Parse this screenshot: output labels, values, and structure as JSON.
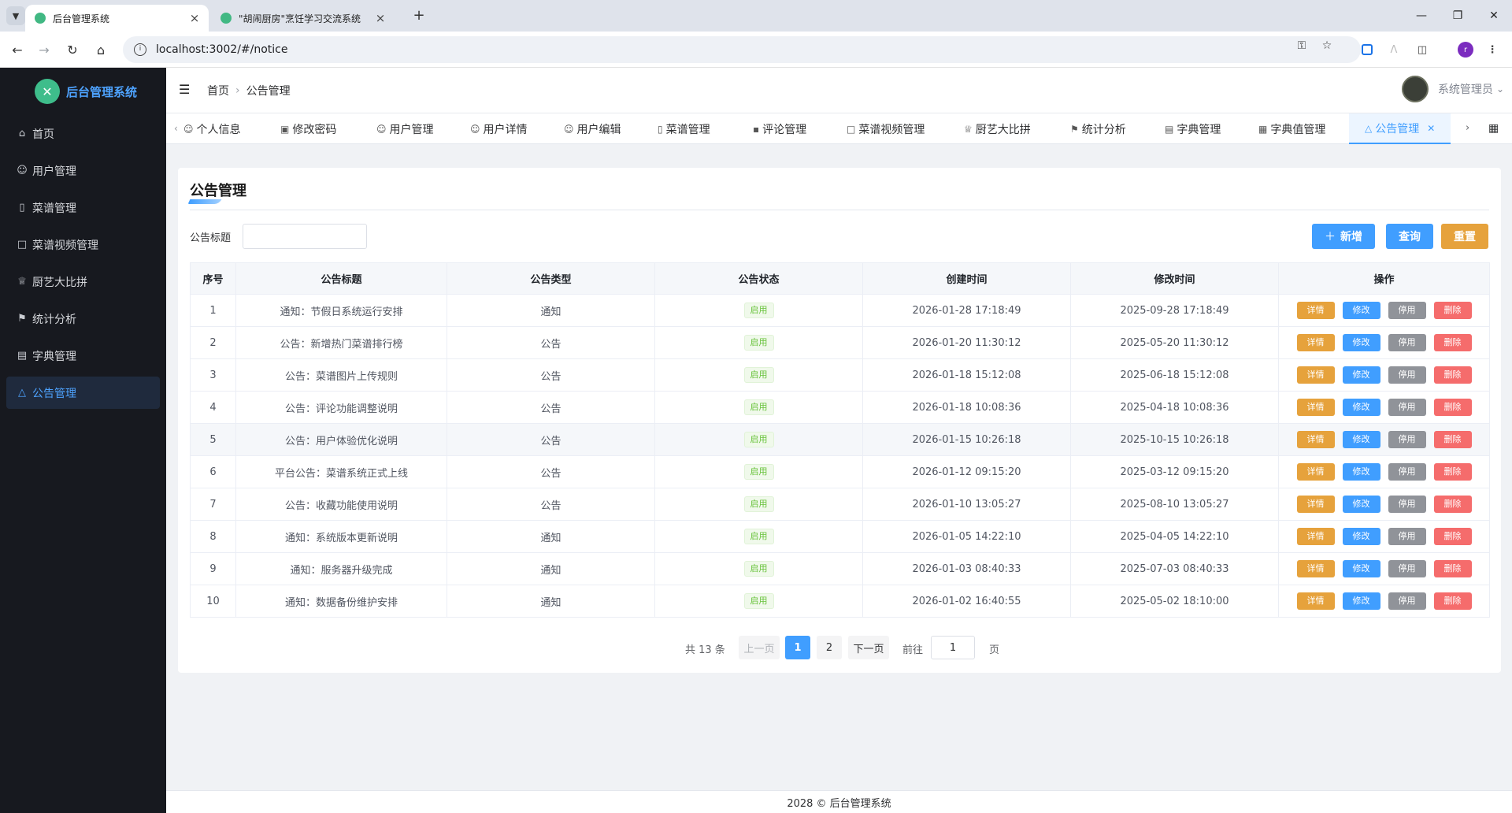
{
  "browser": {
    "tabs": [
      {
        "title": "后台管理系统",
        "active": true
      },
      {
        "title": "\"胡闹厨房\"烹饪学习交流系统",
        "active": false
      }
    ],
    "url": "localhost:3002/#/notice",
    "profile_initial": "r"
  },
  "sidebar": {
    "app_name": "后台管理系统",
    "items": [
      {
        "label": "首页",
        "icon": "home-icon"
      },
      {
        "label": "用户管理",
        "icon": "user-icon"
      },
      {
        "label": "菜谱管理",
        "icon": "book-icon"
      },
      {
        "label": "菜谱视频管理",
        "icon": "video-icon"
      },
      {
        "label": "厨艺大比拼",
        "icon": "trophy-icon"
      },
      {
        "label": "统计分析",
        "icon": "flag-icon"
      },
      {
        "label": "字典管理",
        "icon": "document-icon"
      },
      {
        "label": "公告管理",
        "icon": "bell-icon",
        "active": true
      }
    ]
  },
  "header": {
    "breadcrumb": [
      "首页",
      "公告管理"
    ],
    "username": "系统管理员"
  },
  "tags": [
    {
      "label": "个人信息",
      "icon": "user-icon"
    },
    {
      "label": "修改密码",
      "icon": "lock-icon"
    },
    {
      "label": "用户管理",
      "icon": "user-icon"
    },
    {
      "label": "用户详情",
      "icon": "user-icon"
    },
    {
      "label": "用户编辑",
      "icon": "user-icon"
    },
    {
      "label": "菜谱管理",
      "icon": "book-icon"
    },
    {
      "label": "评论管理",
      "icon": "comment-icon"
    },
    {
      "label": "菜谱视频管理",
      "icon": "video-icon"
    },
    {
      "label": "厨艺大比拼",
      "icon": "trophy-icon"
    },
    {
      "label": "统计分析",
      "icon": "flag-icon"
    },
    {
      "label": "字典管理",
      "icon": "document-icon"
    },
    {
      "label": "字典值管理",
      "icon": "grid-icon"
    },
    {
      "label": "公告管理",
      "icon": "bell-icon",
      "active": true
    }
  ],
  "page": {
    "title": "公告管理",
    "search": {
      "label": "公告标题",
      "value": ""
    },
    "buttons": {
      "add": "新增",
      "query": "查询",
      "reset": "重置"
    },
    "columns": [
      "序号",
      "公告标题",
      "公告类型",
      "公告状态",
      "创建时间",
      "修改时间",
      "操作"
    ],
    "row_actions": {
      "detail": "详情",
      "edit": "修改",
      "disable": "停用",
      "delete": "删除"
    },
    "rows": [
      {
        "no": "1",
        "title": "通知：节假日系统运行安排",
        "type": "通知",
        "status": "启用",
        "created": "2026-01-28 17:18:49",
        "updated": "2025-09-28 17:18:49"
      },
      {
        "no": "2",
        "title": "公告：新增热门菜谱排行榜",
        "type": "公告",
        "status": "启用",
        "created": "2026-01-20 11:30:12",
        "updated": "2025-05-20 11:30:12"
      },
      {
        "no": "3",
        "title": "公告：菜谱图片上传规则",
        "type": "公告",
        "status": "启用",
        "created": "2026-01-18 15:12:08",
        "updated": "2025-06-18 15:12:08"
      },
      {
        "no": "4",
        "title": "公告：评论功能调整说明",
        "type": "公告",
        "status": "启用",
        "created": "2026-01-18 10:08:36",
        "updated": "2025-04-18 10:08:36"
      },
      {
        "no": "5",
        "title": "公告：用户体验优化说明",
        "type": "公告",
        "status": "启用",
        "created": "2026-01-15 10:26:18",
        "updated": "2025-10-15 10:26:18",
        "hover": true
      },
      {
        "no": "6",
        "title": "平台公告：菜谱系统正式上线",
        "type": "公告",
        "status": "启用",
        "created": "2026-01-12 09:15:20",
        "updated": "2025-03-12 09:15:20"
      },
      {
        "no": "7",
        "title": "公告：收藏功能使用说明",
        "type": "公告",
        "status": "启用",
        "created": "2026-01-10 13:05:27",
        "updated": "2025-08-10 13:05:27"
      },
      {
        "no": "8",
        "title": "通知：系统版本更新说明",
        "type": "通知",
        "status": "启用",
        "created": "2026-01-05 14:22:10",
        "updated": "2025-04-05 14:22:10"
      },
      {
        "no": "9",
        "title": "通知：服务器升级完成",
        "type": "通知",
        "status": "启用",
        "created": "2026-01-03 08:40:33",
        "updated": "2025-07-03 08:40:33"
      },
      {
        "no": "10",
        "title": "通知：数据备份维护安排",
        "type": "通知",
        "status": "启用",
        "created": "2026-01-02 16:40:55",
        "updated": "2025-05-02 18:10:00"
      }
    ],
    "pagination": {
      "total_text": "共 13 条",
      "prev": "上一页",
      "pages": [
        "1",
        "2"
      ],
      "current": "1",
      "next": "下一页",
      "goto_label": "前往",
      "goto_value": "1",
      "goto_unit": "页"
    }
  },
  "footer": {
    "text": "2028 © 后台管理系统"
  },
  "colors": {
    "primary": "#409eff",
    "warning": "#e6a23c",
    "danger": "#f56c6c",
    "info": "#909399",
    "success": "#67c23a",
    "sidebar_bg": "#17191f"
  }
}
